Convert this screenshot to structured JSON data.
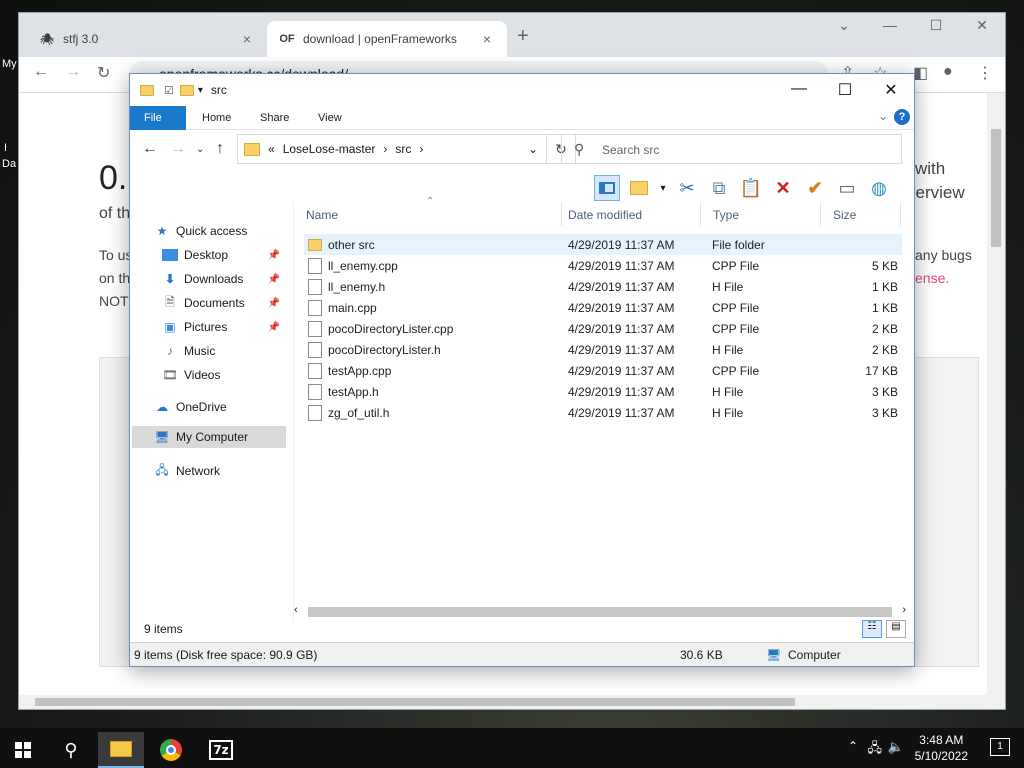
{
  "desktop": {
    "label1": "My",
    "label2": "Da",
    "label3": "I"
  },
  "chrome": {
    "tabs": [
      {
        "title": "stfj 3.0",
        "icon": "bug-icon",
        "close": "×"
      },
      {
        "title": "download | openFrameworks",
        "icon": "of-icon",
        "icon_text": "OF",
        "close": "×"
      }
    ],
    "new_tab": "+",
    "url": "openframeworks.cc/download/",
    "page": {
      "heading": "0.",
      "subtext": "of th",
      "right_line1": "with",
      "right_line2": "verview",
      "para1": "To us",
      "para2": "on th",
      "para3": "NOT",
      "right_para1": "any bugs",
      "right_para2": "ense."
    }
  },
  "explorer": {
    "title": "src",
    "ribbon_tabs": [
      "File",
      "Home",
      "Share",
      "View"
    ],
    "help": "?",
    "address": {
      "prefix": "«",
      "segments": [
        "LoseLose-master",
        "src"
      ]
    },
    "search_placeholder": "Search src",
    "nav": [
      {
        "label": "Quick access",
        "icon": "star-icon"
      },
      {
        "label": "Desktop",
        "icon": "desktop-icon",
        "pinned": true
      },
      {
        "label": "Downloads",
        "icon": "download-icon",
        "pinned": true
      },
      {
        "label": "Documents",
        "icon": "documents-icon",
        "pinned": true
      },
      {
        "label": "Pictures",
        "icon": "pictures-icon",
        "pinned": true
      },
      {
        "label": "Music",
        "icon": "music-icon"
      },
      {
        "label": "Videos",
        "icon": "videos-icon"
      },
      {
        "label": "OneDrive",
        "icon": "cloud-icon"
      },
      {
        "label": "My Computer",
        "icon": "computer-icon"
      },
      {
        "label": "Network",
        "icon": "network-icon"
      }
    ],
    "columns": [
      "Name",
      "Date modified",
      "Type",
      "Size"
    ],
    "files": [
      {
        "name": "other src",
        "date": "4/29/2019 11:37 AM",
        "type": "File folder",
        "size": ""
      },
      {
        "name": "ll_enemy.cpp",
        "date": "4/29/2019 11:37 AM",
        "type": "CPP File",
        "size": "5 KB"
      },
      {
        "name": "ll_enemy.h",
        "date": "4/29/2019 11:37 AM",
        "type": "H File",
        "size": "1 KB"
      },
      {
        "name": "main.cpp",
        "date": "4/29/2019 11:37 AM",
        "type": "CPP File",
        "size": "1 KB"
      },
      {
        "name": "pocoDirectoryLister.cpp",
        "date": "4/29/2019 11:37 AM",
        "type": "CPP File",
        "size": "2 KB"
      },
      {
        "name": "pocoDirectoryLister.h",
        "date": "4/29/2019 11:37 AM",
        "type": "H File",
        "size": "2 KB"
      },
      {
        "name": "testApp.cpp",
        "date": "4/29/2019 11:37 AM",
        "type": "CPP File",
        "size": "17 KB"
      },
      {
        "name": "testApp.h",
        "date": "4/29/2019 11:37 AM",
        "type": "H File",
        "size": "3 KB"
      },
      {
        "name": "zg_of_util.h",
        "date": "4/29/2019 11:37 AM",
        "type": "H File",
        "size": "3 KB"
      }
    ],
    "status": {
      "items": "9 items",
      "detail": "9 items (Disk free space: 90.9 GB)",
      "size": "30.6 KB",
      "location": "Computer"
    }
  },
  "taskbar": {
    "time": "3:48 AM",
    "date": "5/10/2022",
    "notification_count": "1",
    "sevenzip_label": "7z"
  }
}
